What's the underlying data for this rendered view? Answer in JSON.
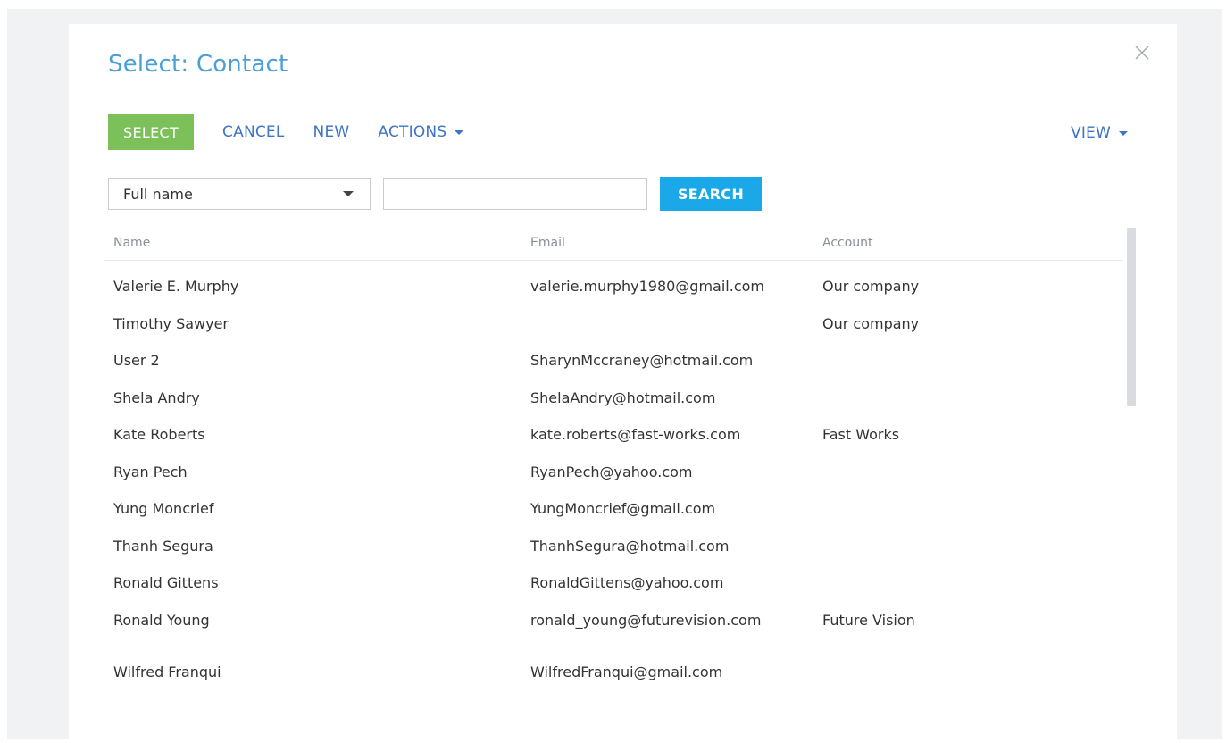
{
  "dialog": {
    "title": "Select: Contact"
  },
  "toolbar": {
    "select_label": "SELECT",
    "cancel_label": "CANCEL",
    "new_label": "NEW",
    "actions_label": "ACTIONS",
    "view_label": "VIEW"
  },
  "search": {
    "field_selected": "Full name",
    "input_value": "",
    "button_label": "SEARCH"
  },
  "grid": {
    "columns": [
      "Name",
      "Email",
      "Account"
    ],
    "rows": [
      {
        "name": "Valerie E. Murphy",
        "email": "valerie.murphy1980@gmail.com",
        "account": "Our company"
      },
      {
        "name": "Timothy Sawyer",
        "email": "",
        "account": "Our company"
      },
      {
        "name": "User 2",
        "email": "SharynMccraney@hotmail.com",
        "account": ""
      },
      {
        "name": "Shela Andry",
        "email": "ShelaAndry@hotmail.com",
        "account": ""
      },
      {
        "name": "Kate Roberts",
        "email": "kate.roberts@fast-works.com",
        "account": "Fast Works"
      },
      {
        "name": "Ryan Pech",
        "email": "RyanPech@yahoo.com",
        "account": ""
      },
      {
        "name": "Yung Moncrief",
        "email": "YungMoncrief@gmail.com",
        "account": ""
      },
      {
        "name": "Thanh Segura",
        "email": "ThanhSegura@hotmail.com",
        "account": ""
      },
      {
        "name": "Ronald Gittens",
        "email": "RonaldGittens@yahoo.com",
        "account": ""
      },
      {
        "name": "Ronald Young",
        "email": "ronald_young@futurevision.com",
        "account": "Future Vision"
      },
      {
        "name": "Wilfred Franqui",
        "email": "WilfredFranqui@gmail.com",
        "account": ""
      }
    ]
  },
  "colors": {
    "title": "#4a9fd6",
    "select_button": "#7cc05a",
    "search_button": "#1aa8e8",
    "link": "#3e74c4"
  }
}
